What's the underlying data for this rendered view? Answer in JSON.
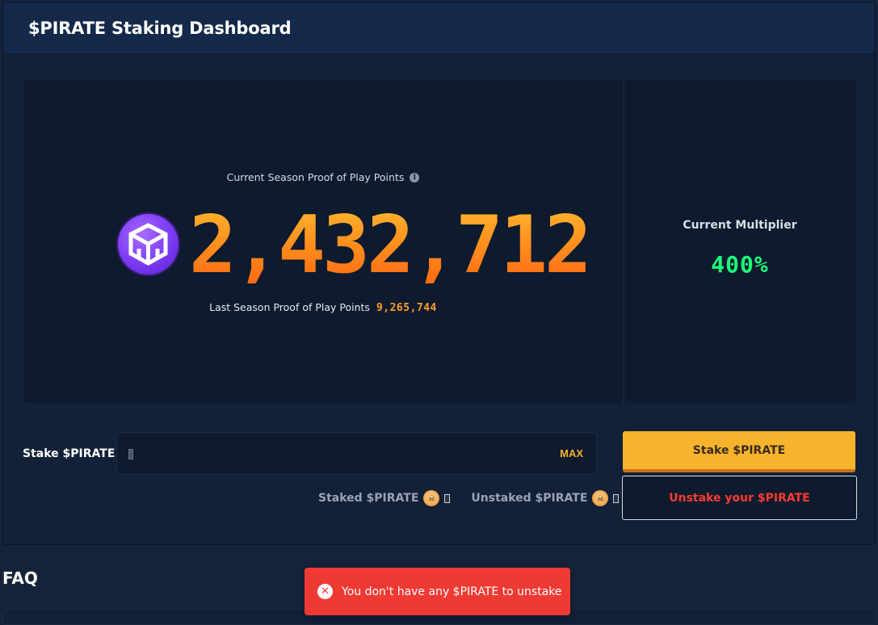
{
  "header": {
    "title": "$PIRATE Staking Dashboard"
  },
  "points": {
    "label": "Current Season Proof of Play Points",
    "info_icon": "info-icon",
    "logo_icon": "proof-of-play-logo",
    "value": "2,432,712",
    "last_season_label": "Last Season Proof of Play Points",
    "last_season_value": "9,265,744"
  },
  "multiplier": {
    "label": "Current Multiplier",
    "value": "400%"
  },
  "stake": {
    "label": "Stake $PIRATE",
    "input_value": "",
    "max_label": "MAX",
    "stake_button": "Stake $PIRATE",
    "unstake_button": "Unstake your $PIRATE",
    "staked_label": "Staked $PIRATE",
    "unstaked_label": "Unstaked $PIRATE",
    "token_icon": "pirate-skull-icon"
  },
  "faq": {
    "title": "FAQ"
  },
  "toast": {
    "message": "You don't have any $PIRATE to unstake",
    "icon": "error-x-icon"
  },
  "colors": {
    "accent_orange": "#ff8a1c",
    "multiplier_green": "#1bff7a",
    "stake_yellow": "#f5b42b",
    "error_red": "#ef3a34"
  }
}
